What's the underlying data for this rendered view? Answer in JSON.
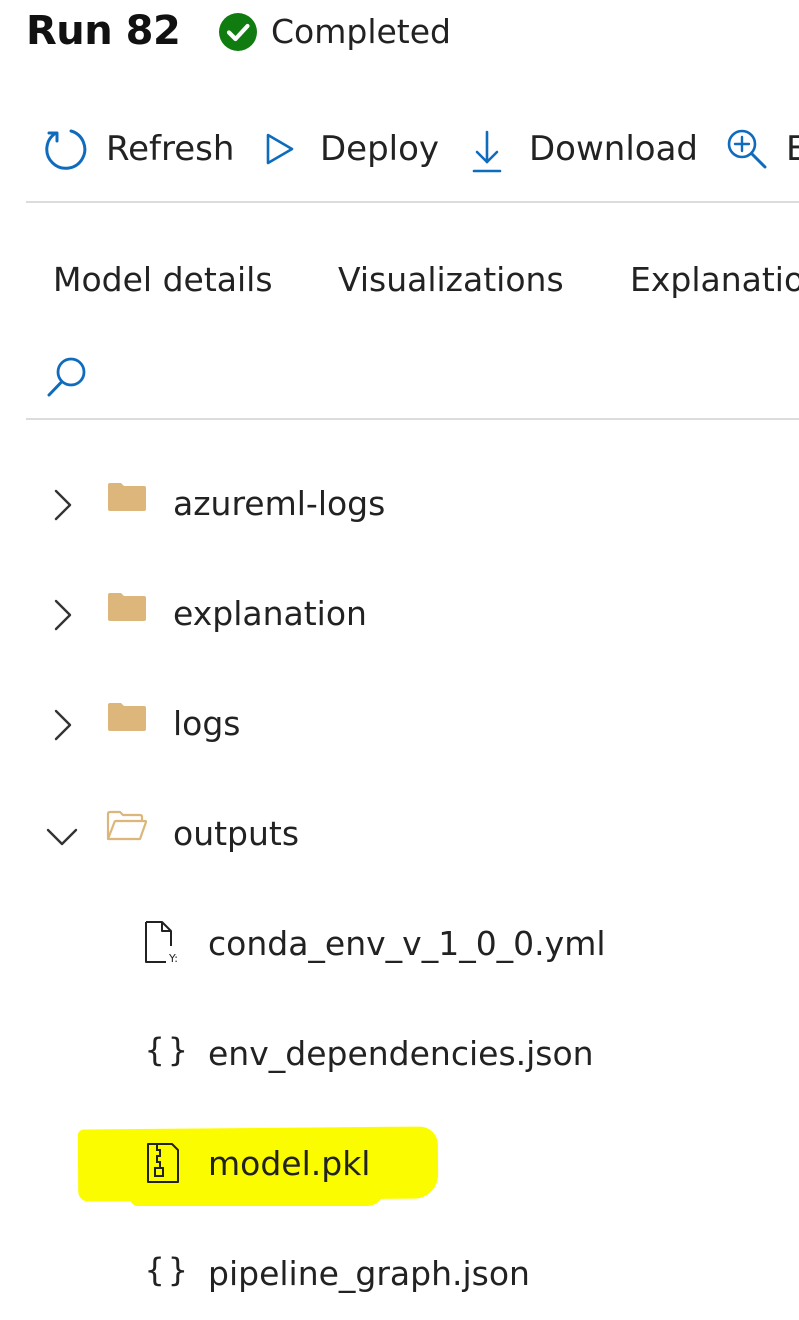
{
  "header": {
    "run_title": "Run 82",
    "status": "Completed",
    "status_color": "#107c10"
  },
  "toolbar": {
    "refresh_label": "Refresh",
    "deploy_label": "Deploy",
    "download_label": "Download",
    "explain_label": "E",
    "icon_color": "#0f6cbd"
  },
  "tabs": [
    {
      "label": "Model details"
    },
    {
      "label": "Visualizations"
    },
    {
      "label": "Explanation"
    }
  ],
  "search": {
    "icon": "search-icon"
  },
  "tree": {
    "folders": [
      {
        "label": "azureml-logs",
        "expanded": false
      },
      {
        "label": "explanation",
        "expanded": false
      },
      {
        "label": "logs",
        "expanded": false
      },
      {
        "label": "outputs",
        "expanded": true
      }
    ],
    "files": [
      {
        "label": "conda_env_v_1_0_0.yml",
        "icon": "yaml-file-icon"
      },
      {
        "label": "env_dependencies.json",
        "icon": "json-braces-icon"
      },
      {
        "label": "model.pkl",
        "icon": "zip-file-icon",
        "highlighted": true
      },
      {
        "label": "pipeline_graph.json",
        "icon": "json-braces-icon"
      }
    ],
    "folder_color": "#dcb67a",
    "highlight_color": "#fcfc00"
  }
}
